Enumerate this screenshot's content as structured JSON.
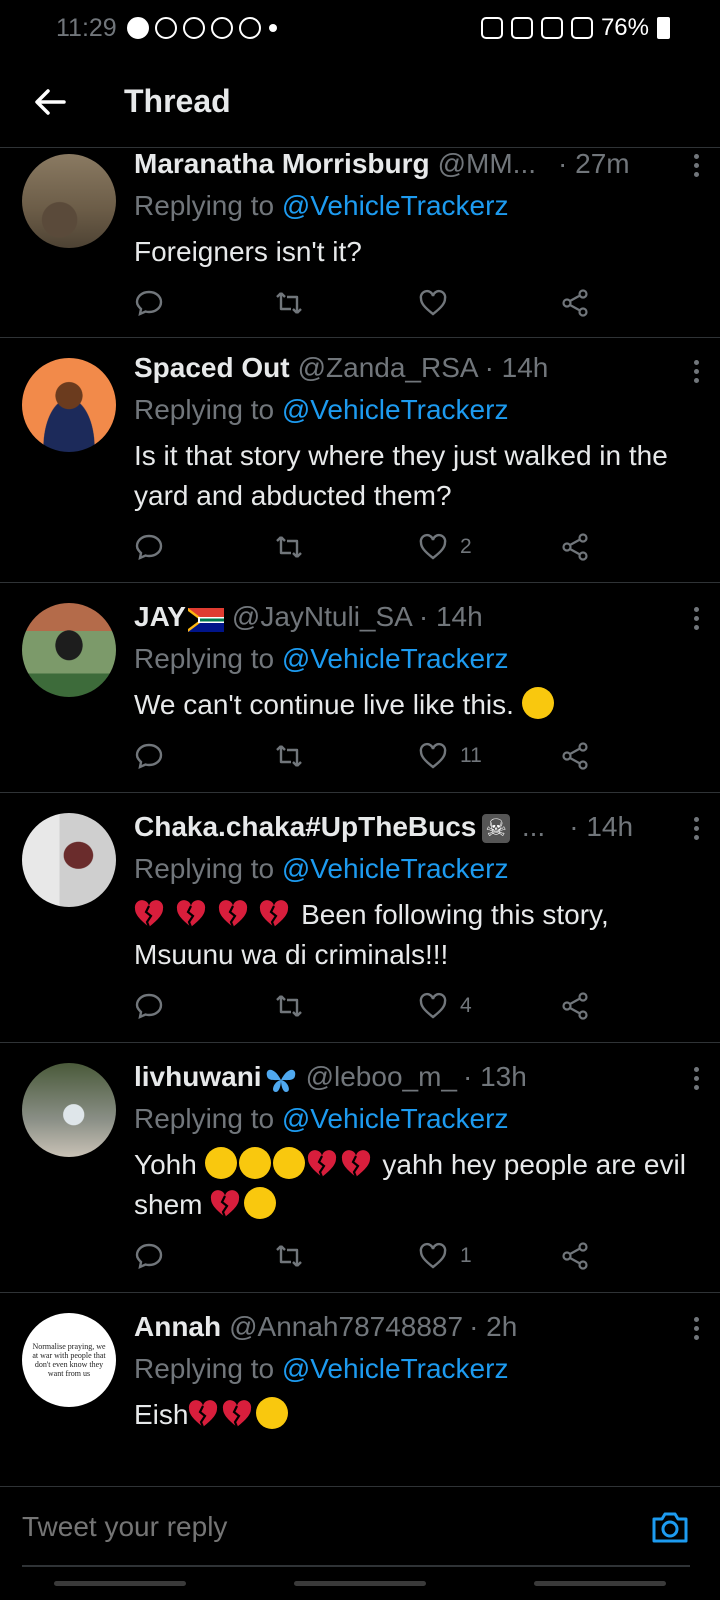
{
  "status_bar": {
    "time": "11:29",
    "battery": "76%"
  },
  "header": {
    "title": "Thread"
  },
  "tweets": [
    {
      "name": "Maranatha Morrisburg",
      "handle": "@MM...",
      "time": "· 27m",
      "replying_prefix": "Replying to ",
      "replying_to": "@VehicleTrackerz",
      "text": "Foreigners isn't it?",
      "likes": ""
    },
    {
      "name": "Spaced Out",
      "handle": "@Zanda_RSA",
      "time": "· 14h",
      "replying_prefix": "Replying to ",
      "replying_to": "@VehicleTrackerz",
      "text": "Is it that story where they just walked in the yard and abducted them?",
      "likes": "2"
    },
    {
      "name": "JAY",
      "handle": "@JayNtuli_SA",
      "time": "· 14h",
      "replying_prefix": "Replying to ",
      "replying_to": "@VehicleTrackerz",
      "text": "We can't continue live like this.",
      "likes": "11"
    },
    {
      "name": "Chaka.chaka#UpTheBucs",
      "handle": "...",
      "time": "· 14h",
      "replying_prefix": "Replying to ",
      "replying_to": "@VehicleTrackerz",
      "text": "Been following this story, Msuunu wa di criminals!!!",
      "likes": "4"
    },
    {
      "name": "livhuwani",
      "handle": "@leboo_m_",
      "time": "· 13h",
      "replying_prefix": "Replying to ",
      "replying_to": "@VehicleTrackerz",
      "text_a": "Yohh",
      "text_b": "yahh hey people are evil shem",
      "likes": "1"
    },
    {
      "name": "Annah",
      "handle": "@Annah78748887",
      "time": "· 2h",
      "replying_prefix": "Replying to ",
      "replying_to": "@VehicleTrackerz",
      "text": "Eish",
      "avatar_text": "Normalise praying, we at war with people that don't even know they want from us"
    }
  ],
  "reply_bar": {
    "placeholder": "Tweet your reply"
  },
  "colors": {
    "accent": "#1d9bf0",
    "muted": "#71767b",
    "heart_broken": "#d81e3c",
    "emoji_face": "#f9c80e"
  }
}
